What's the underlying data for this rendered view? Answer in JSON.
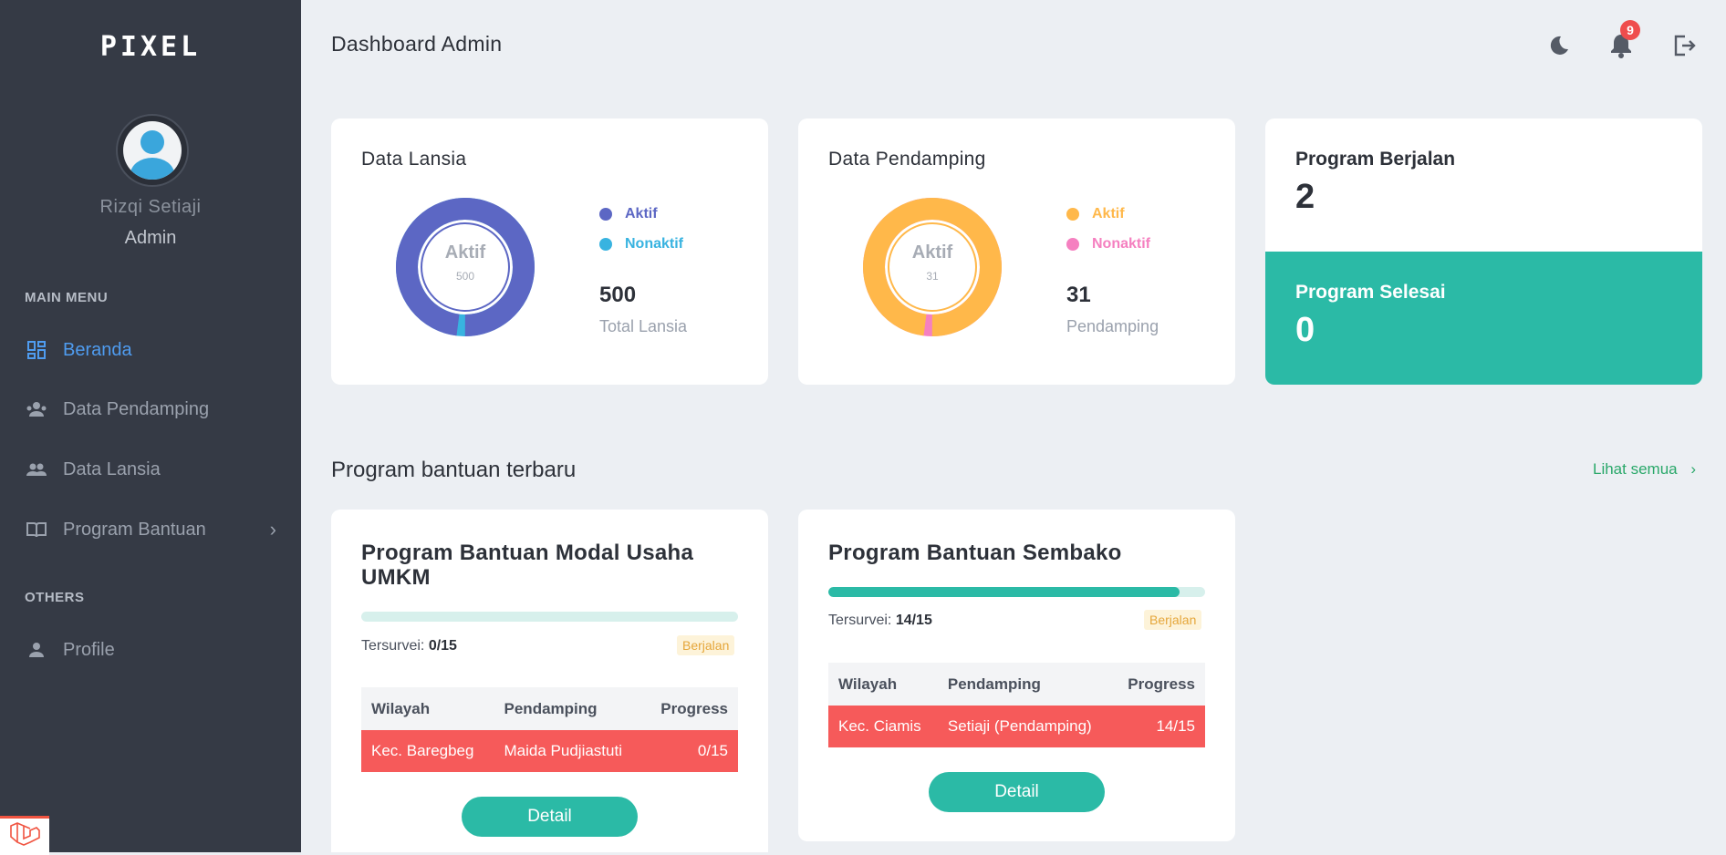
{
  "sidebar": {
    "logo": "PIXEL",
    "user": {
      "name": "Rizqi Setiaji",
      "role": "Admin"
    },
    "main_menu_label": "MAIN MENU",
    "items": [
      {
        "label": "Beranda",
        "icon": "dashboard-icon",
        "active": true
      },
      {
        "label": "Data Pendamping",
        "icon": "user-group-icon"
      },
      {
        "label": "Data Lansia",
        "icon": "users-icon"
      },
      {
        "label": "Program Bantuan",
        "icon": "book-icon",
        "has_submenu": true
      }
    ],
    "others_label": "OTHERS",
    "others_items": [
      {
        "label": "Profile",
        "icon": "person-icon"
      }
    ]
  },
  "header": {
    "title": "Dashboard Admin",
    "notification_count": "9"
  },
  "cards": {
    "lansia": {
      "title": "Data Lansia",
      "donut_label": "Aktif",
      "donut_value": "500",
      "legend_active": "Aktif",
      "legend_inactive": "Nonaktif",
      "total": "500",
      "total_label": "Total Lansia",
      "active_color": "#5c67c4",
      "inactive_color": "#38b3e0",
      "active_fraction": 0.98
    },
    "pendamping": {
      "title": "Data Pendamping",
      "donut_label": "Aktif",
      "donut_value": "31",
      "legend_active": "Aktif",
      "legend_inactive": "Nonaktif",
      "total": "31",
      "total_label": "Pendamping",
      "active_color": "#ffb84a",
      "inactive_color": "#f580c0",
      "active_fraction": 0.98
    },
    "program_berjalan": {
      "title": "Program Berjalan",
      "value": "2"
    },
    "program_selesai": {
      "title": "Program Selesai",
      "value": "0"
    }
  },
  "programs_section": {
    "title": "Program bantuan terbaru",
    "see_all": "Lihat semua",
    "columns": {
      "wilayah": "Wilayah",
      "pendamping": "Pendamping",
      "progress": "Progress"
    },
    "tersurvei_label": "Tersurvei:",
    "detail_label": "Detail",
    "programs": [
      {
        "title": "Program Bantuan Modal Usaha UMKM",
        "tersurvei": "0/15",
        "progress_fraction": 0.0,
        "status": "Berjalan",
        "row": {
          "wilayah": "Kec. Baregbeg",
          "pendamping": "Maida Pudjiastuti",
          "progress": "0/15"
        }
      },
      {
        "title": "Program Bantuan Sembako",
        "tersurvei": "14/15",
        "progress_fraction": 0.933,
        "status": "Berjalan",
        "row": {
          "wilayah": "Kec. Ciamis",
          "pendamping": "Setiaji (Pendamping)",
          "progress": "14/15"
        }
      }
    ]
  }
}
